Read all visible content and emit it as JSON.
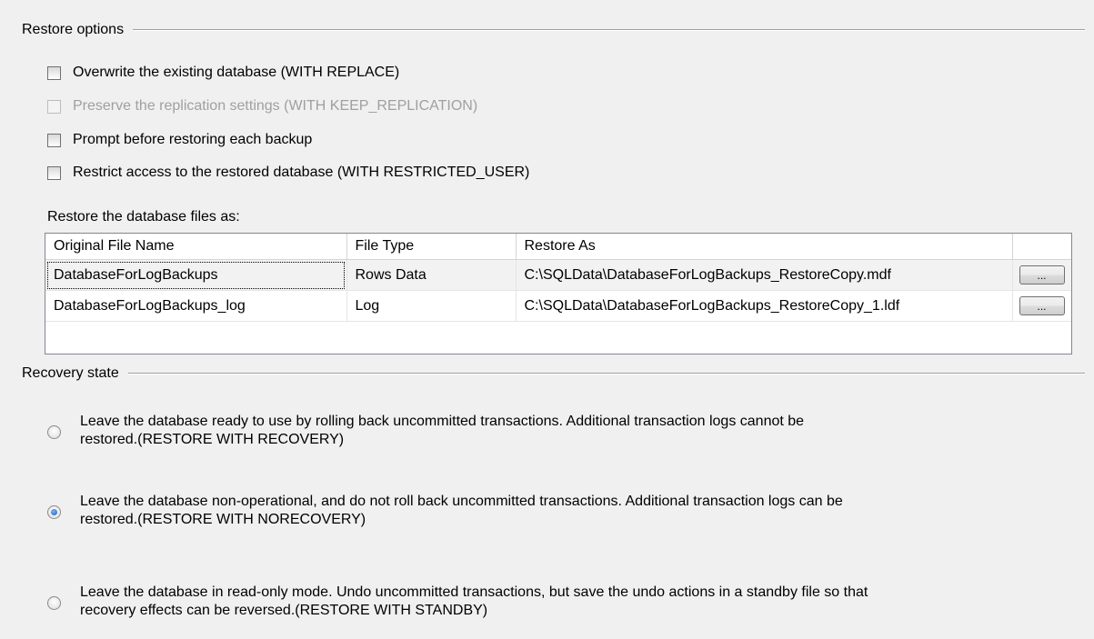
{
  "restore_options": {
    "title": "Restore options",
    "checkboxes": [
      {
        "label": "Overwrite the existing database (WITH REPLACE)",
        "checked": false,
        "enabled": true
      },
      {
        "label": "Preserve the replication settings (WITH KEEP_REPLICATION)",
        "checked": false,
        "enabled": false
      },
      {
        "label": "Prompt before restoring each backup",
        "checked": false,
        "enabled": true
      },
      {
        "label": "Restrict access to the restored database (WITH RESTRICTED_USER)",
        "checked": false,
        "enabled": true
      }
    ]
  },
  "files": {
    "label": "Restore the database files as:",
    "columns": [
      "Original File Name",
      "File Type",
      "Restore As",
      ""
    ],
    "rows": [
      {
        "original": "DatabaseForLogBackups",
        "type": "Rows Data",
        "restore_as": "C:\\SQLData\\DatabaseForLogBackups_RestoreCopy.mdf",
        "button": "..."
      },
      {
        "original": "DatabaseForLogBackups_log",
        "type": "Log",
        "restore_as": "C:\\SQLData\\DatabaseForLogBackups_RestoreCopy_1.ldf",
        "button": "..."
      }
    ]
  },
  "recovery_state": {
    "title": "Recovery state",
    "options": [
      {
        "line1": "Leave the database ready to use by rolling back uncommitted transactions. Additional transaction logs cannot be",
        "line2": "restored.(RESTORE WITH RECOVERY)",
        "checked": false
      },
      {
        "line1": "Leave the database non-operational, and do not roll back uncommitted transactions. Additional transaction logs can be",
        "line2": "restored.(RESTORE WITH NORECOVERY)",
        "checked": true
      },
      {
        "line1": "Leave the database in read-only mode. Undo uncommitted transactions, but save the undo actions in a standby file so that",
        "line2": "recovery effects can be reversed.(RESTORE WITH STANDBY)",
        "checked": false
      }
    ]
  }
}
